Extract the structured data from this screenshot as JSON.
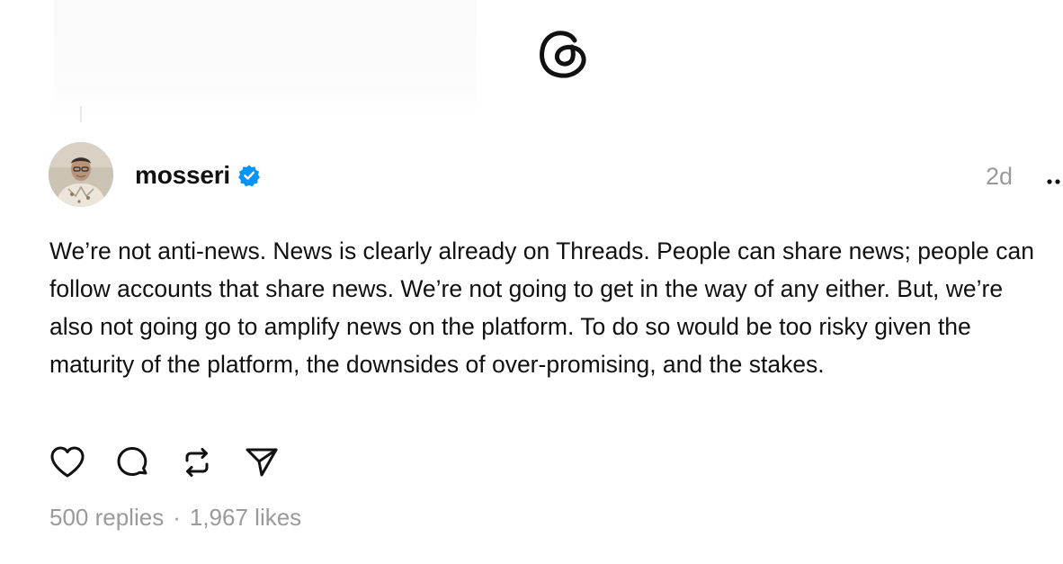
{
  "header": {
    "logo_icon": "threads-logo-icon"
  },
  "post": {
    "username": "mosseri",
    "verified_icon": "verified-badge-icon",
    "timestamp": "2d",
    "more_icon": "more-options-icon",
    "text": "We’re not anti-news. News is clearly already on Threads. People can share news; people can follow accounts that share news. We’re not going to get in the way of any either. But, we’re also not going go to amplify news on the platform. To do so would be too risky given the maturity of the platform, the downsides of over-promising, and the stakes.",
    "actions": {
      "like_icon": "heart-icon",
      "reply_icon": "comment-icon",
      "repost_icon": "repost-icon",
      "share_icon": "send-icon"
    },
    "stats": {
      "replies": "500 replies",
      "separator": "·",
      "likes": "1,967 likes"
    }
  },
  "colors": {
    "text": "#111111",
    "muted": "#9a9a9a",
    "verified_blue": "#0095f6",
    "background": "#ffffff"
  }
}
